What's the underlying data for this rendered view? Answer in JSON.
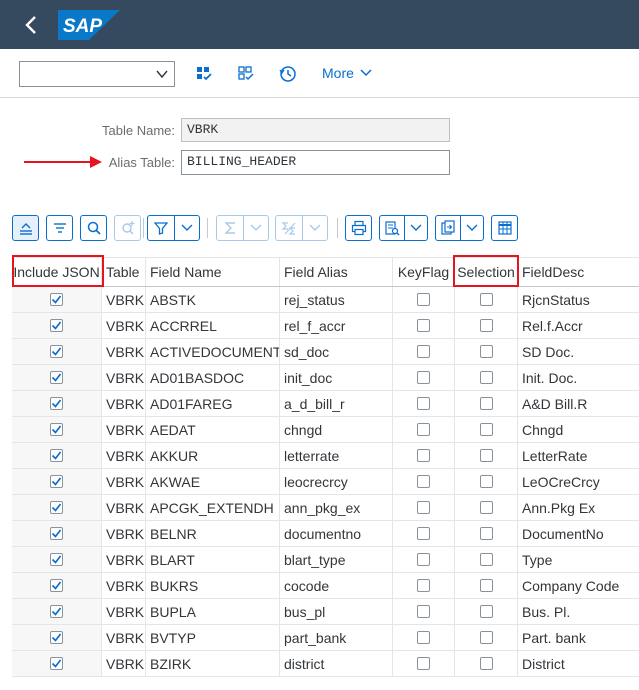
{
  "shell": {
    "logo_text": "SAP",
    "brand_color": "#354a5f",
    "logo_color": "#0a78c8"
  },
  "toolbar": {
    "dropdown_value": "",
    "icons": [
      "grid-select-icon",
      "grid-deselect-icon",
      "history-icon"
    ],
    "more_label": "More"
  },
  "form": {
    "table_name_label": "Table Name:",
    "table_name_value": "VBRK",
    "alias_table_label": "Alias Table:",
    "alias_table_value": "BILLING_HEADER"
  },
  "table_toolbar": {
    "icons": [
      "collapse-icon",
      "filter-list-icon",
      "search-icon",
      "zoom-add-icon",
      "filter-icon",
      "sum-icon",
      "subtotal-icon",
      "print-icon",
      "view-icon",
      "export-icon",
      "layout-icon"
    ]
  },
  "grid": {
    "headers": {
      "include_json": "Include JSON",
      "table": "Table",
      "field_name": "Field Name",
      "field_alias": "Field Alias",
      "key_flag": "KeyFlag",
      "selection": "Selection",
      "field_desc": "FieldDesc"
    },
    "rows": [
      {
        "include": true,
        "table": "VBRK",
        "field": "ABSTK",
        "alias": "rej_status",
        "key": false,
        "sel": false,
        "desc": "RjcnStatus"
      },
      {
        "include": true,
        "table": "VBRK",
        "field": "ACCRREL",
        "alias": "rel_f_accr",
        "key": false,
        "sel": false,
        "desc": "Rel.f.Accr"
      },
      {
        "include": true,
        "table": "VBRK",
        "field": "ACTIVEDOCUMENT",
        "alias": "sd_doc",
        "key": false,
        "sel": false,
        "desc": "SD Doc."
      },
      {
        "include": true,
        "table": "VBRK",
        "field": "AD01BASDOC",
        "alias": "init_doc",
        "key": false,
        "sel": false,
        "desc": "Init. Doc."
      },
      {
        "include": true,
        "table": "VBRK",
        "field": "AD01FAREG",
        "alias": "a_d_bill_r",
        "key": false,
        "sel": false,
        "desc": "A&D Bill.R"
      },
      {
        "include": true,
        "table": "VBRK",
        "field": "AEDAT",
        "alias": "chngd",
        "key": false,
        "sel": false,
        "desc": "Chngd"
      },
      {
        "include": true,
        "table": "VBRK",
        "field": "AKKUR",
        "alias": "letterrate",
        "key": false,
        "sel": false,
        "desc": "LetterRate"
      },
      {
        "include": true,
        "table": "VBRK",
        "field": "AKWAE",
        "alias": "leocrecrcy",
        "key": false,
        "sel": false,
        "desc": "LeOCreCrcy"
      },
      {
        "include": true,
        "table": "VBRK",
        "field": "APCGK_EXTENDH",
        "alias": "ann_pkg_ex",
        "key": false,
        "sel": false,
        "desc": "Ann.Pkg Ex"
      },
      {
        "include": true,
        "table": "VBRK",
        "field": "BELNR",
        "alias": "documentno",
        "key": false,
        "sel": false,
        "desc": "DocumentNo"
      },
      {
        "include": true,
        "table": "VBRK",
        "field": "BLART",
        "alias": "blart_type",
        "key": false,
        "sel": false,
        "desc": "Type"
      },
      {
        "include": true,
        "table": "VBRK",
        "field": "BUKRS",
        "alias": "cocode",
        "key": false,
        "sel": false,
        "desc": "Company Code"
      },
      {
        "include": true,
        "table": "VBRK",
        "field": "BUPLA",
        "alias": "bus_pl",
        "key": false,
        "sel": false,
        "desc": "Bus. Pl."
      },
      {
        "include": true,
        "table": "VBRK",
        "field": "BVTYP",
        "alias": "part_bank",
        "key": false,
        "sel": false,
        "desc": "Part. bank"
      },
      {
        "include": true,
        "table": "VBRK",
        "field": "BZIRK",
        "alias": "district",
        "key": false,
        "sel": false,
        "desc": "District"
      }
    ]
  },
  "annotations": {
    "highlight_color": "#e8141d"
  }
}
